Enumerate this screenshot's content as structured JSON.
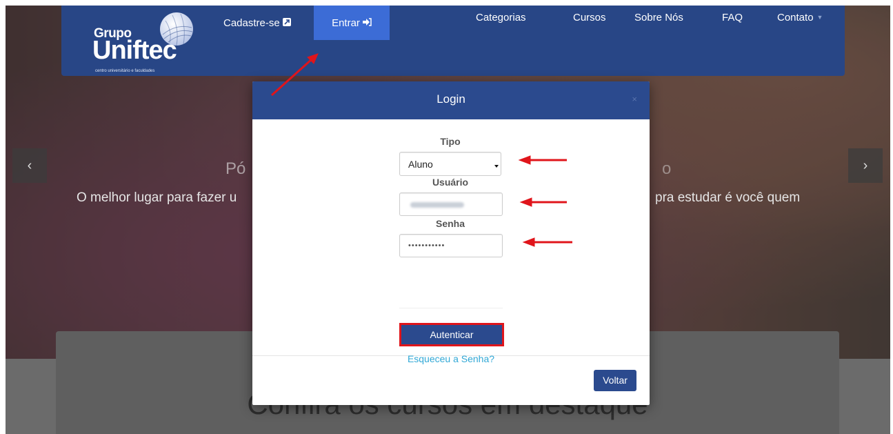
{
  "brand": {
    "line1": "Grupo",
    "line2": "Uniftec",
    "tagline": "centro universitário e faculdades"
  },
  "nav": {
    "cadastre": "Cadastre-se",
    "entrar": "Entrar",
    "categorias": "Categorias",
    "cursos": "Cursos",
    "sobre": "Sobre Nós",
    "faq": "FAQ",
    "contato": "Contato"
  },
  "hero": {
    "title_left": "Pó",
    "title_right": "o",
    "subtitle_left": "O melhor lugar para fazer u",
    "subtitle_right": "pra estudar é você quem"
  },
  "card": {
    "title": "Confira os cursos em destaque"
  },
  "modal": {
    "title": "Login",
    "close": "×",
    "tipo_label": "Tipo",
    "tipo_value": "Aluno",
    "usuario_label": "Usuário",
    "senha_label": "Senha",
    "senha_value": "•••••••••••",
    "submit": "Autenticar",
    "forgot": "Esqueceu a Senha?",
    "back": "Voltar"
  },
  "icons": {
    "cadastre": "external-link-icon",
    "entrar": "sign-in-icon",
    "contato": "caret-down-icon",
    "prev": "chevron-left-icon",
    "next": "chevron-right-icon",
    "select": "select-arrow-icon"
  },
  "colors": {
    "brand_blue": "#2b4a8e",
    "active_tab": "#3c6cd6",
    "annotation_red": "#e0151b",
    "link": "#31a8d6"
  }
}
